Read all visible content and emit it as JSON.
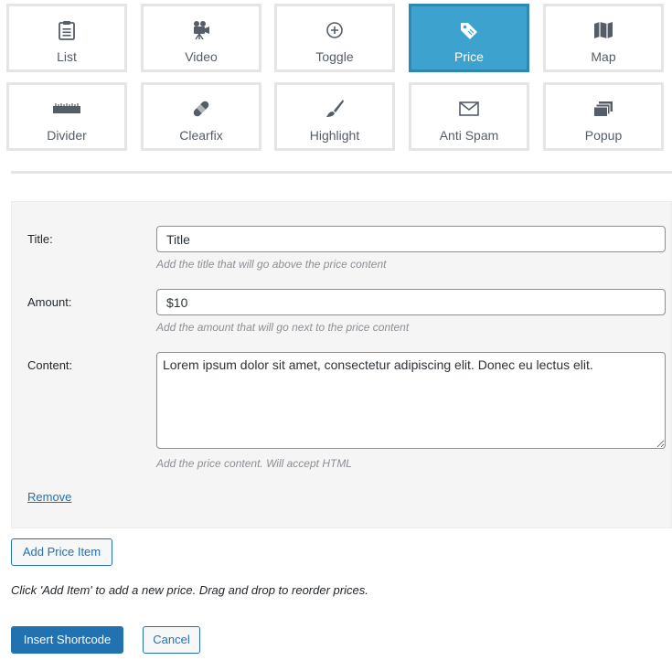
{
  "tiles": [
    {
      "label": "List",
      "icon": "clipboard-icon"
    },
    {
      "label": "Video",
      "icon": "video-camera-icon"
    },
    {
      "label": "Toggle",
      "icon": "plus-circle-icon"
    },
    {
      "label": "Price",
      "icon": "tag-icon",
      "active": true
    },
    {
      "label": "Map",
      "icon": "map-icon"
    },
    {
      "label": "Divider",
      "icon": "ruler-icon"
    },
    {
      "label": "Clearfix",
      "icon": "bandage-icon"
    },
    {
      "label": "Highlight",
      "icon": "paintbrush-icon"
    },
    {
      "label": "Anti Spam",
      "icon": "envelope-icon"
    },
    {
      "label": "Popup",
      "icon": "stacked-windows-icon"
    }
  ],
  "colors": {
    "active_tile": "#3ea2cf",
    "primary_button": "#2271b1",
    "tile_border": "#e5e5e5"
  },
  "form": {
    "title_label": "Title:",
    "title_value": "Title",
    "title_help": "Add the title that will go above the price content",
    "amount_label": "Amount:",
    "amount_value": "$10",
    "amount_help": "Add the amount that will go next to the price content",
    "content_label": "Content:",
    "content_value": "Lorem ipsum dolor sit amet, consectetur adipiscing elit. Donec eu lectus elit.",
    "content_help": "Add the price content. Will accept HTML",
    "remove_label": "Remove"
  },
  "actions": {
    "add_item_label": "Add Price Item",
    "note": "Click 'Add Item' to add a new price. Drag and drop to reorder prices.",
    "insert_label": "Insert Shortcode",
    "cancel_label": "Cancel"
  }
}
